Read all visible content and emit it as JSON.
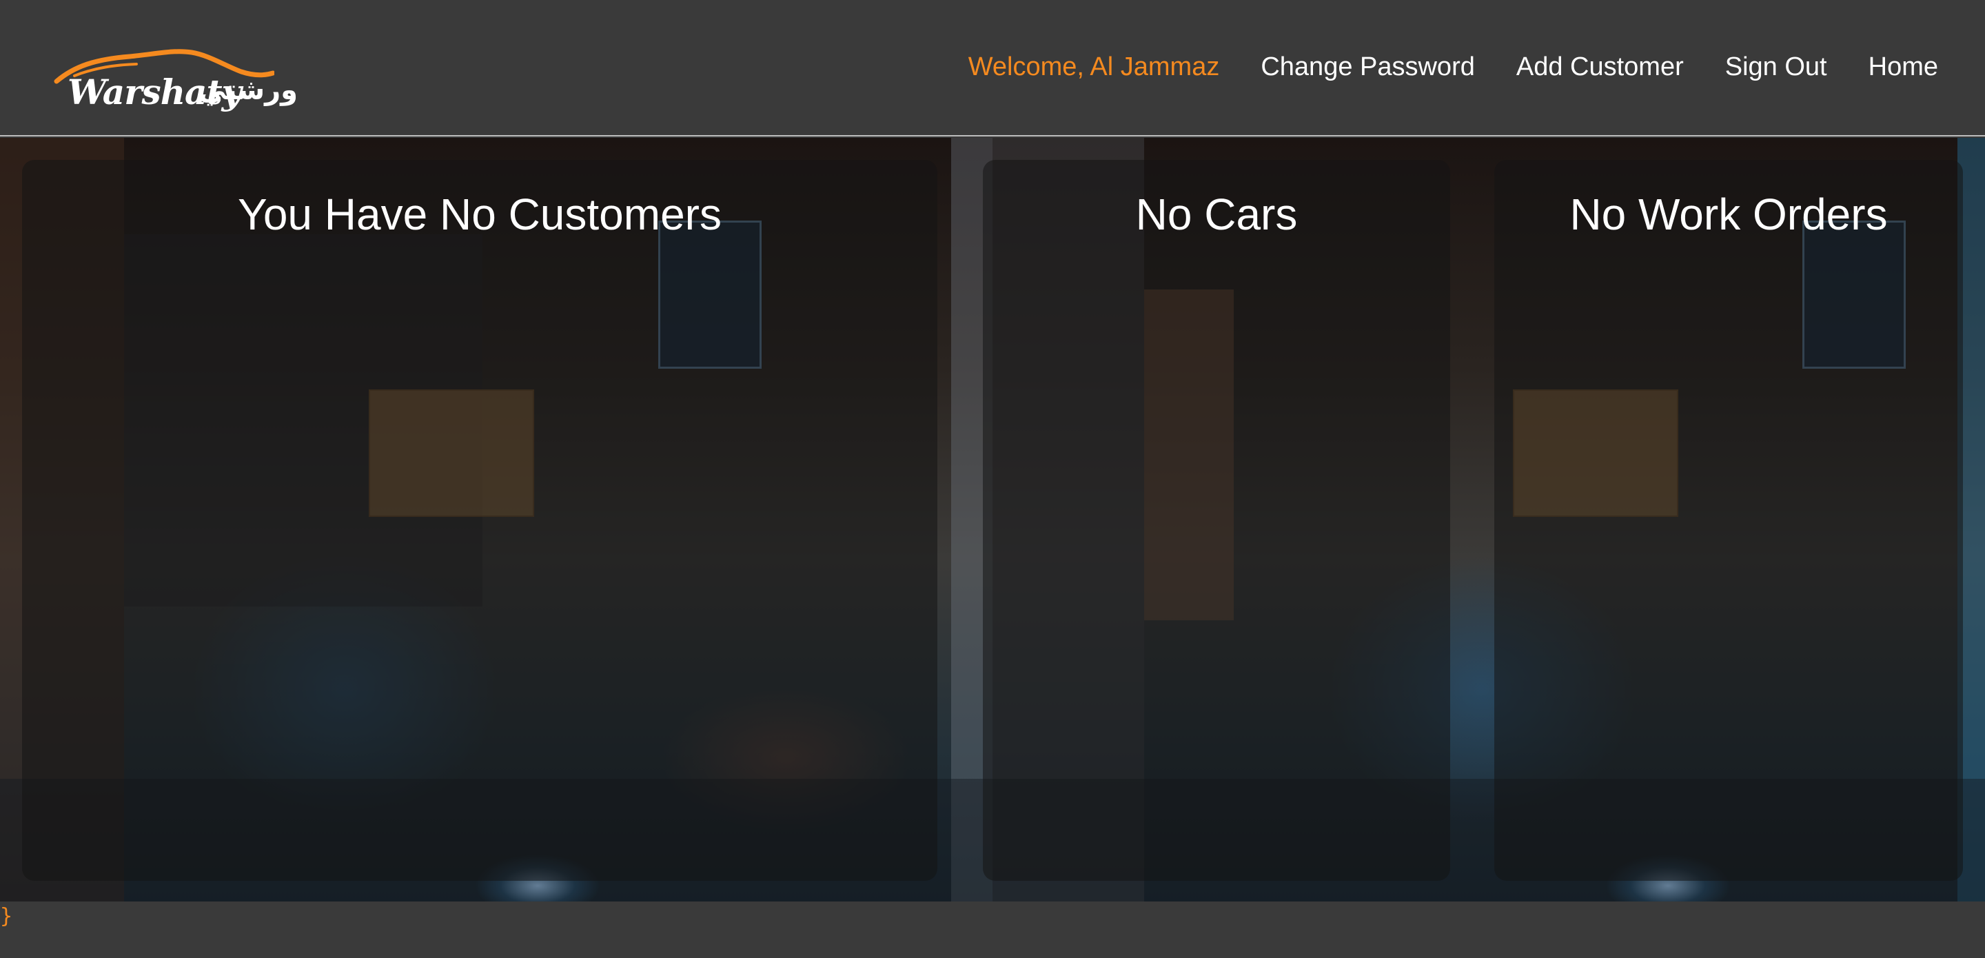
{
  "brand": {
    "name_latin": "Warshaty",
    "name_arabic": "ورشتي"
  },
  "nav": {
    "welcome": "Welcome, Al Jammaz",
    "change_password": "Change Password",
    "add_customer": "Add Customer",
    "sign_out": "Sign Out",
    "home": "Home"
  },
  "panels": {
    "customers_title": "You Have No Customers",
    "cars_title": "No Cars",
    "work_orders_title": "No Work Orders"
  },
  "footer": {
    "stray_text": "}"
  },
  "colors": {
    "background": "#3a3a3a",
    "accent": "#f58a1f",
    "text": "#ffffff"
  }
}
